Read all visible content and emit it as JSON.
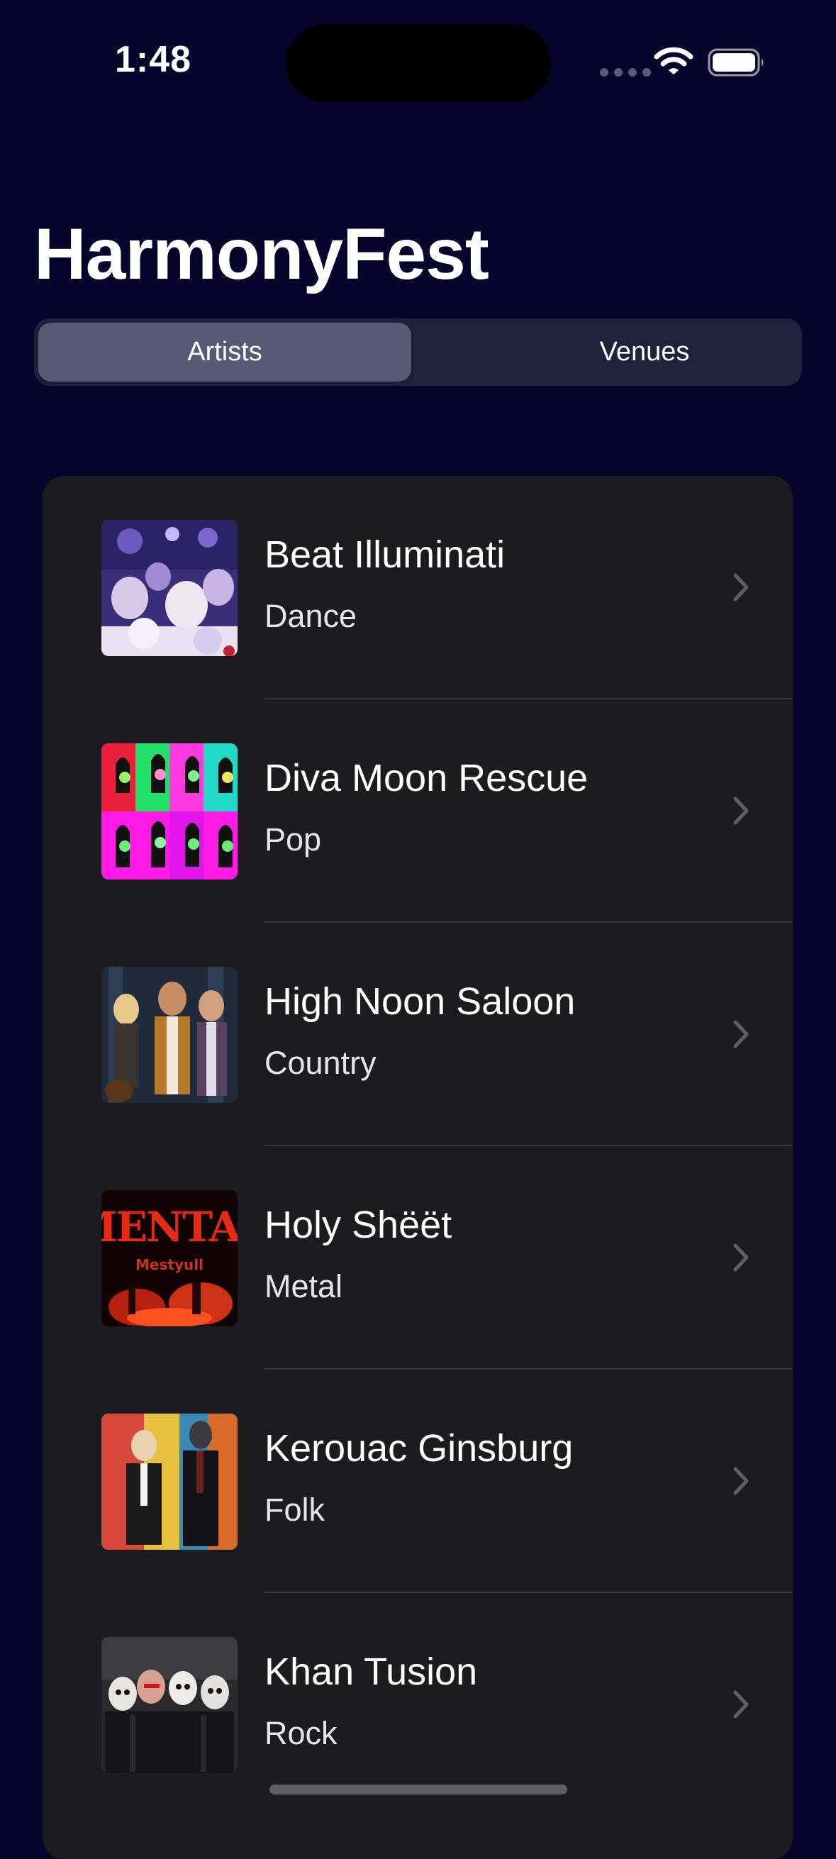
{
  "status_bar": {
    "time": "1:48"
  },
  "app": {
    "title": "HarmonyFest"
  },
  "segments": [
    {
      "label": "Artists",
      "selected": true
    },
    {
      "label": "Venues",
      "selected": false
    }
  ],
  "artists": [
    {
      "name": "Beat Illuminati",
      "genre": "Dance",
      "image": "dance-crowd-photo"
    },
    {
      "name": "Diva Moon Rescue",
      "genre": "Pop",
      "image": "pop-art-collage"
    },
    {
      "name": "High Noon Saloon",
      "genre": "Country",
      "image": "country-band-photo"
    },
    {
      "name": "Holy Shëët",
      "genre": "Metal",
      "image": "metal-poster",
      "image_text": "MENTAL Mestyull"
    },
    {
      "name": "Kerouac Ginsburg",
      "genre": "Folk",
      "image": "folk-painting"
    },
    {
      "name": "Khan Tusion",
      "genre": "Rock",
      "image": "rock-band-photo"
    }
  ],
  "colors": {
    "background": "#06042a",
    "list_background": "#1c1c1e",
    "segment_track": "#22213c",
    "segment_selected": "#5a5975",
    "chevron": "#5f5f63"
  },
  "icons": {
    "wifi": "wifi-icon",
    "battery": "battery-icon",
    "row_disclosure": "chevron-right-icon"
  }
}
